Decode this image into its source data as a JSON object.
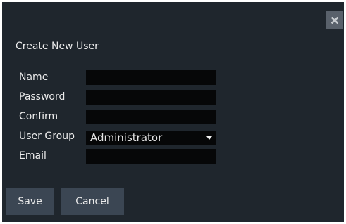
{
  "dialog": {
    "title": "Create New User",
    "close_icon": "close-icon"
  },
  "form": {
    "name_label": "Name",
    "name_value": "",
    "password_label": "Password",
    "password_value": "",
    "confirm_label": "Confirm",
    "confirm_value": "",
    "user_group_label": "User Group",
    "user_group_selected": "Administrator",
    "email_label": "Email",
    "email_value": ""
  },
  "buttons": {
    "save_label": "Save",
    "cancel_label": "Cancel"
  }
}
